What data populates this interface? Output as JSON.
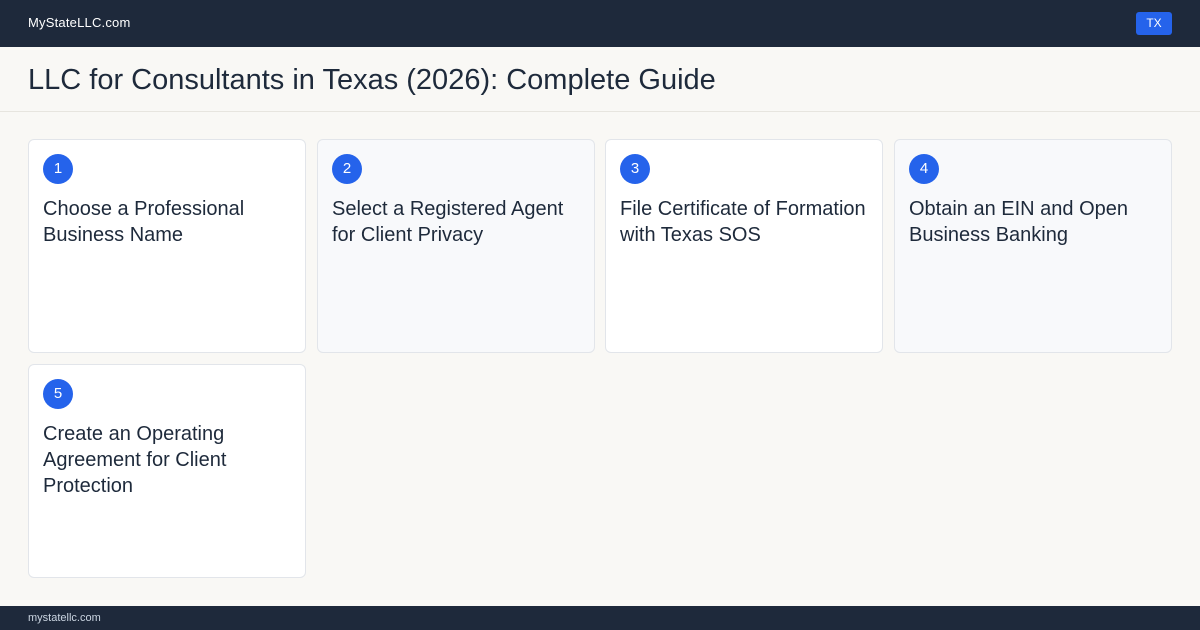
{
  "header": {
    "brand": "MyStateLLC.com",
    "state_badge": "TX"
  },
  "page": {
    "title": "LLC for Consultants in Texas (2026): Complete Guide"
  },
  "steps": [
    {
      "number": "1",
      "title": "Choose a Professional Business Name"
    },
    {
      "number": "2",
      "title": "Select a Registered Agent for Client Privacy"
    },
    {
      "number": "3",
      "title": "File Certificate of Formation with Texas SOS"
    },
    {
      "number": "4",
      "title": "Obtain an EIN and Open Business Banking"
    },
    {
      "number": "5",
      "title": "Create an Operating Agreement for Client Protection"
    }
  ],
  "footer": {
    "domain": "mystatellc.com"
  },
  "colors": {
    "header_bg": "#1e293b",
    "accent": "#2563eb",
    "page_bg": "#f9f8f5"
  }
}
